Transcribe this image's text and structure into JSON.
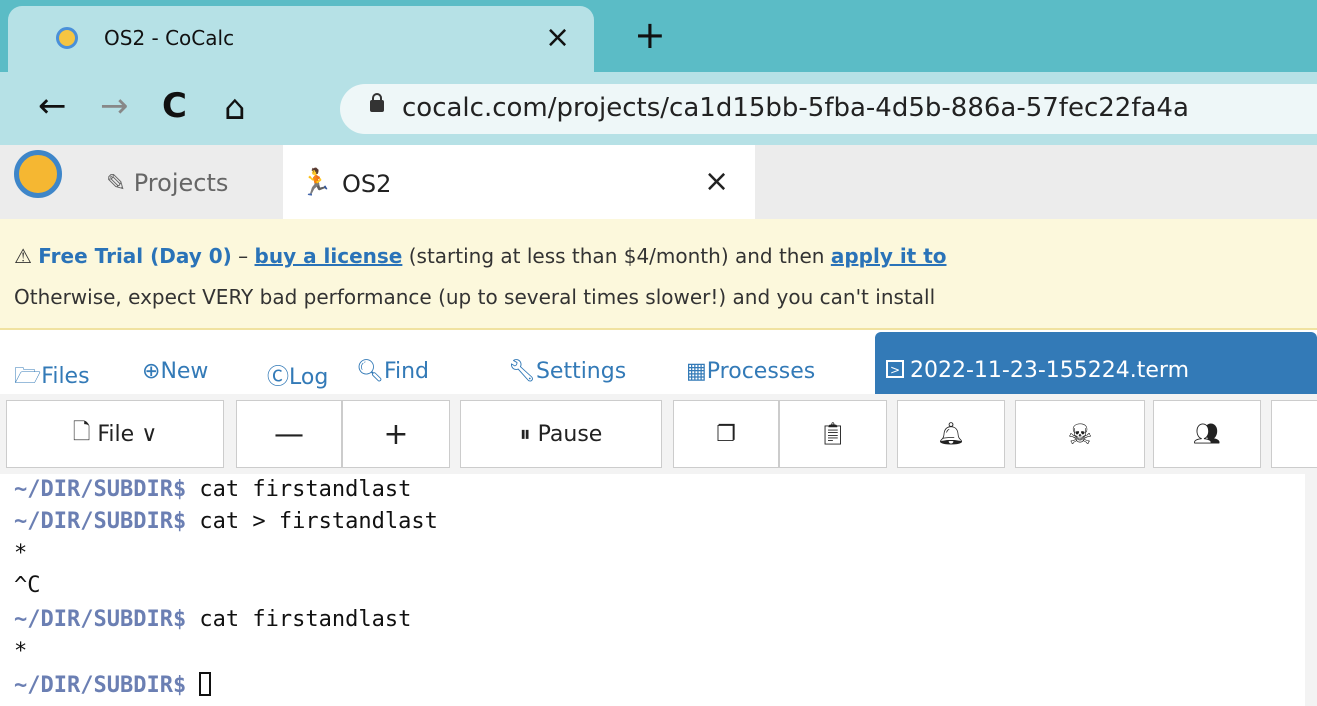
{
  "browser": {
    "tab_title": "OS2 - CoCalc",
    "tab_close": "×",
    "new_tab": "+",
    "url": "cocalc.com/projects/ca1d15bb-5fba-4d5b-886a-57fec22fa4a",
    "icons": {
      "back": "←",
      "forward": "→",
      "reload": "C",
      "home": "⌂"
    }
  },
  "cocalc": {
    "projects_label": "Projects",
    "project_name": "OS2",
    "project_close": "×"
  },
  "banner": {
    "free_trial": "Free Trial (Day 0)",
    "dash": " – ",
    "buy_link": "buy a license",
    "mid_text": " (starting at less than $4/month) and then ",
    "apply_link": "apply it to",
    "line2": "Otherwise, expect VERY bad performance (up to several times slower!) and you can't install"
  },
  "nav": {
    "files": "Files",
    "new": "New",
    "log": "Log",
    "find": "Find",
    "settings": "Settings",
    "processes": "Processes",
    "active_file": "2022-11-23-155224.term"
  },
  "toolbar": {
    "file": "File",
    "minus": "—",
    "plus": "+",
    "pause": "Pause"
  },
  "terminal": {
    "prompt": "~/DIR/SUBDIR$",
    "lines": [
      {
        "prompt": "~/DIR/SUBDIR$",
        "cmd": " cat firstandlast"
      },
      {
        "prompt": "~/DIR/SUBDIR$",
        "cmd": " cat > firstandlast"
      },
      {
        "prompt": "",
        "cmd": "*"
      },
      {
        "prompt": "",
        "cmd": "^C"
      },
      {
        "prompt": "~/DIR/SUBDIR$",
        "cmd": " cat firstandlast"
      },
      {
        "prompt": "",
        "cmd": "*"
      },
      {
        "prompt": "~/DIR/SUBDIR$",
        "cmd": " "
      }
    ]
  },
  "colors": {
    "tabstrip": "#5bbcc6",
    "tab_active": "#b6e1e6",
    "cocalc_blue": "#337ab7",
    "banner_bg": "#fcf8dc",
    "prompt": "#6b7fb3"
  }
}
